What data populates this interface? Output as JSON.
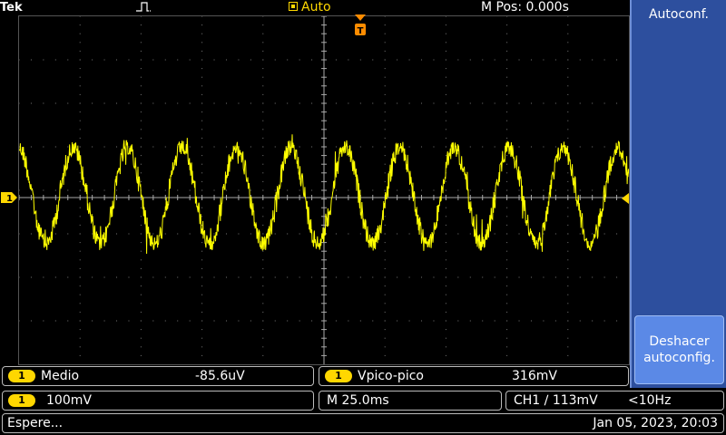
{
  "header": {
    "brand": "Tek",
    "trigger_state": "Auto",
    "m_pos": "M Pos: 0.000s"
  },
  "sidebar": {
    "title": "Autoconf.",
    "undo_button": "Deshacer\nautoconfig."
  },
  "measurements": [
    {
      "channel": "1",
      "label": "Medio",
      "value": "-85.6uV"
    },
    {
      "channel": "1",
      "label": "Vpico-pico",
      "value": "316mV"
    }
  ],
  "settings": {
    "channel": "1",
    "vertical_scale": "100mV",
    "timebase": "M 25.0ms",
    "trigger": "CH1 ∕ 113mV",
    "frequency": "<10Hz"
  },
  "status": {
    "message": "Espere...",
    "datetime": "Jan 05, 2023, 20:03"
  },
  "channel_marker": "1",
  "colors": {
    "trace": "#ffff00",
    "sidebar": "#2d4f9e",
    "button": "#5b89e6",
    "badge": "#ffd700",
    "trigger_marker": "#ff8c00"
  },
  "waveform": {
    "cycles_on_screen": 11.2,
    "vpp_mv": 316,
    "volts_per_div_mv": 100,
    "time_per_div_ms": 25.0,
    "frequency_hz": 44.6
  }
}
